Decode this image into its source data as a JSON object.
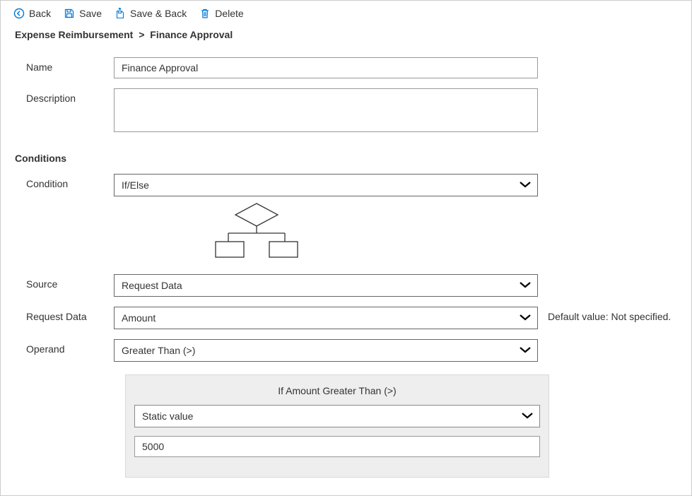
{
  "toolbar": {
    "back_label": "Back",
    "save_label": "Save",
    "save_back_label": "Save & Back",
    "delete_label": "Delete"
  },
  "breadcrumb": {
    "parent": "Expense Reimbursement",
    "separator": ">",
    "current": "Finance Approval"
  },
  "form": {
    "name_label": "Name",
    "name_value": "Finance Approval",
    "description_label": "Description",
    "description_value": ""
  },
  "conditions": {
    "heading": "Conditions",
    "condition_label": "Condition",
    "condition_value": "If/Else",
    "source_label": "Source",
    "source_value": "Request Data",
    "request_data_label": "Request Data",
    "request_data_value": "Amount",
    "request_data_hint": "Default value: Not specified.",
    "operand_label": "Operand",
    "operand_value": "Greater Than (>)",
    "panel_title": "If Amount Greater Than (>)",
    "value_type": "Static value",
    "value": "5000"
  },
  "colors": {
    "link": "#0078d4",
    "border": "#999999"
  }
}
